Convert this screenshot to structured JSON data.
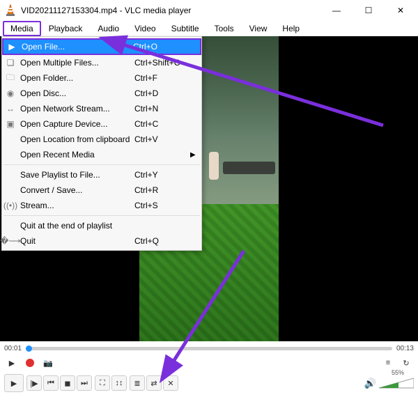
{
  "title": "VID20211127153304.mp4 - VLC media player",
  "menubar": [
    "Media",
    "Playback",
    "Audio",
    "Video",
    "Subtitle",
    "Tools",
    "View",
    "Help"
  ],
  "menu_selected_index": 0,
  "dropdown": [
    {
      "type": "item",
      "icon": "▶",
      "label": "Open File...",
      "shortcut": "Ctrl+O",
      "highlight": true
    },
    {
      "type": "item",
      "icon": "❏",
      "label": "Open Multiple Files...",
      "shortcut": "Ctrl+Shift+O"
    },
    {
      "type": "item",
      "icon": "🗀",
      "label": "Open Folder...",
      "shortcut": "Ctrl+F"
    },
    {
      "type": "item",
      "icon": "◉",
      "label": "Open Disc...",
      "shortcut": "Ctrl+D"
    },
    {
      "type": "item",
      "icon": "↔",
      "label": "Open Network Stream...",
      "shortcut": "Ctrl+N"
    },
    {
      "type": "item",
      "icon": "▣",
      "label": "Open Capture Device...",
      "shortcut": "Ctrl+C"
    },
    {
      "type": "item",
      "icon": "",
      "label": "Open Location from clipboard",
      "shortcut": "Ctrl+V"
    },
    {
      "type": "item",
      "icon": "",
      "label": "Open Recent Media",
      "shortcut": "",
      "submenu": true
    },
    {
      "type": "sep"
    },
    {
      "type": "item",
      "icon": "",
      "label": "Save Playlist to File...",
      "shortcut": "Ctrl+Y"
    },
    {
      "type": "item",
      "icon": "",
      "label": "Convert / Save...",
      "shortcut": "Ctrl+R"
    },
    {
      "type": "item",
      "icon": "((•))",
      "label": "Stream...",
      "shortcut": "Ctrl+S"
    },
    {
      "type": "sep"
    },
    {
      "type": "item",
      "icon": "",
      "label": "Quit at the end of playlist",
      "shortcut": ""
    },
    {
      "type": "item",
      "icon": "�⟶",
      "label": "Quit",
      "shortcut": "Ctrl+Q"
    }
  ],
  "time_elapsed": "00:01",
  "time_total": "00:13",
  "volume_pct": "55%",
  "buttons1": {
    "play": "▶",
    "record": "rec",
    "snapshot": "📷",
    "playlist": "≡",
    "loop": "↻"
  },
  "buttons2": {
    "bigplay": "▶",
    "seqplay": "|▶",
    "prev": "⏮",
    "stop": "◼",
    "next": "⏭",
    "full": "⛶",
    "ext": "↕↕",
    "list": "≣",
    "repeat": "⇄",
    "shuffle": "✕"
  },
  "win": {
    "min": "—",
    "max": "☐",
    "close": "✕"
  }
}
